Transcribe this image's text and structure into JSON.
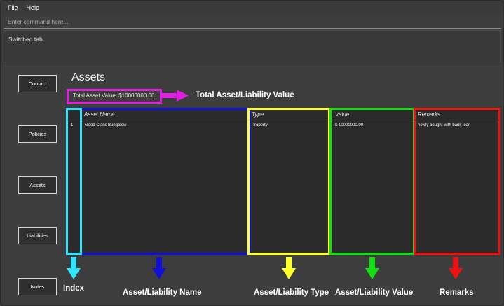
{
  "menu": {
    "file": "File",
    "help": "Help"
  },
  "command": {
    "placeholder": "Enter command here..."
  },
  "result": {
    "text": "Switched tab"
  },
  "sidebar": {
    "contact": "Contact",
    "policies": "Policies",
    "assets": "Assets",
    "liabilities": "Liabilities",
    "notes": "Notes"
  },
  "main": {
    "title": "Assets",
    "total_value": "Total Asset Value: $10000000.00"
  },
  "table": {
    "headers": {
      "name": "Asset Name",
      "type": "Type",
      "value": "Value",
      "remarks": "Remarks"
    },
    "rows": [
      {
        "index": "1",
        "name": "Good Class Bungalow",
        "type": "Property",
        "value": "$ 10000000.00",
        "remarks": "newly bought with bank loan"
      }
    ]
  },
  "annotations": {
    "total": "Total Asset/Liability Value",
    "index": "Index",
    "name": "Asset/Liability Name",
    "type": "Asset/Liability Type",
    "value": "Asset/Liability Value",
    "remarks": "Remarks"
  },
  "colors": {
    "index": "#2ee6ff",
    "name": "#1010d8",
    "type": "#ffff2a",
    "value": "#10e010",
    "remarks": "#ee1111",
    "total": "#e21ee2"
  }
}
